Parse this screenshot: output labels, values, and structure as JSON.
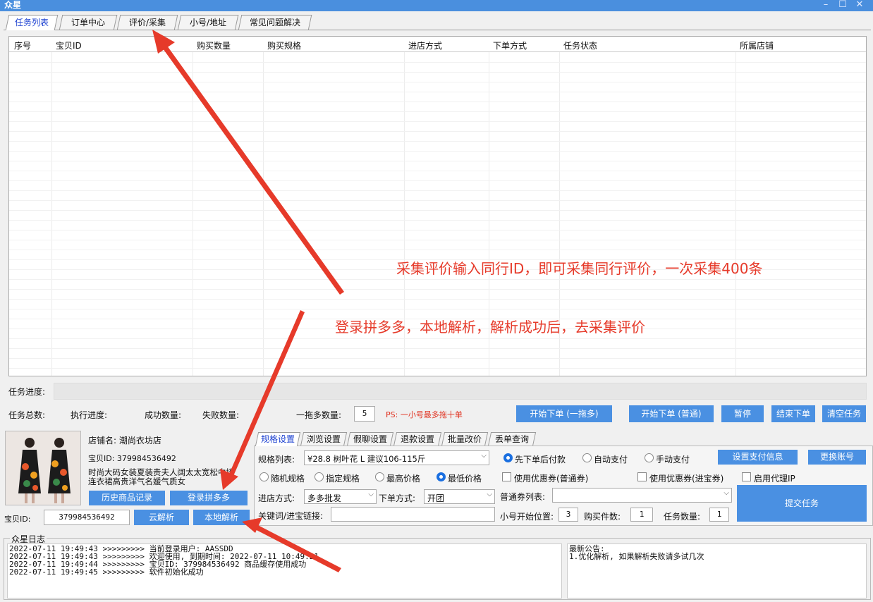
{
  "window": {
    "title": "众星",
    "min_icon": "minimize-icon",
    "max_icon": "maximize-icon",
    "close_icon": "close-icon"
  },
  "main_tabs": [
    {
      "label": "任务列表"
    },
    {
      "label": "订单中心"
    },
    {
      "label": "评价/采集"
    },
    {
      "label": "小号/地址"
    },
    {
      "label": "常见问题解决"
    }
  ],
  "table": {
    "columns": [
      "序号",
      "宝贝ID",
      "购买数量",
      "购买规格",
      "进店方式",
      "下单方式",
      "任务状态",
      "所属店铺"
    ]
  },
  "progress": {
    "label": "任务进度:"
  },
  "stats": {
    "total": "任务总数:",
    "exec": "执行进度:",
    "success": "成功数量:",
    "fail": "失败数量:",
    "multi_label": "一拖多数量:",
    "multi_value": "5",
    "ps": "PS: 一小号最多拖十单"
  },
  "action_buttons": {
    "start_multi": "开始下单 (一拖多)",
    "start_normal": "开始下单 (普通)",
    "pause": "暂停",
    "end": "结束下单",
    "clear": "清空任务"
  },
  "product": {
    "shop_name": "店铺名: 潮尚衣坊店",
    "item_id": "宝贝ID: 379984536492",
    "title_line1": "时尚大码女装夏装贵夫人阔太太宽松中接",
    "title_line2": "连衣裙高贵洋气名媛气质女",
    "history_btn": "历史商品记录",
    "login_btn": "登录拼多多",
    "id_label": "宝贝ID:",
    "id_value": "379984536492",
    "cloud_btn": "云解析",
    "local_btn": "本地解析"
  },
  "settings_tabs": [
    {
      "label": "规格设置"
    },
    {
      "label": "浏览设置"
    },
    {
      "label": "假聊设置"
    },
    {
      "label": "退款设置"
    },
    {
      "label": "批量改价"
    },
    {
      "label": "丢单查询"
    }
  ],
  "settings": {
    "spec_label": "规格列表:",
    "spec_value": "¥28.8  树叶花 L 建议106-115斤",
    "radio_random": "随机规格",
    "radio_specified": "指定规格",
    "radio_highest": "最高价格",
    "radio_lowest": "最低价格",
    "entry_label": "进店方式:",
    "entry_value": "多多批发",
    "order_label": "下单方式:",
    "order_value": "开团",
    "keyword_label": "关键词/进宝链接:",
    "keyword_value": "",
    "pay_after": "先下单后付款",
    "pay_auto": "自动支付",
    "pay_manual": "手动支付",
    "set_pay_btn": "设置支付信息",
    "switch_account_btn": "更换账号",
    "coupon_normal": "使用优惠券(普通券)",
    "coupon_jinbao": "使用优惠券(进宝券)",
    "proxy": "启用代理IP",
    "coupon_list_label": "普通券列表:",
    "start_pos_label": "小号开始位置:",
    "start_pos_value": "3",
    "buy_count_label": "购买件数:",
    "buy_count_value": "1",
    "task_count_label": "任务数量:",
    "task_count_value": "1",
    "submit_btn": "提交任务"
  },
  "log": {
    "title": "众星日志",
    "lines": [
      "2022-07-11 19:49:43 >>>>>>>>> 当前登录用户: AASSDD",
      "2022-07-11 19:49:43 >>>>>>>>> 欢迎使用, 到期时间: 2022-07-11 10:49:21",
      "2022-07-11 19:49:44 >>>>>>>>> 宝贝ID: 379984536492 商品缓存使用成功",
      "2022-07-11 19:49:45 >>>>>>>>> 软件初始化成功"
    ],
    "notice_title": "最新公告:",
    "notice_text": "1.优化解析, 如果解析失败请多试几次"
  },
  "annotations": {
    "a1": "采集评价输入同行ID，即可采集同行评价，一次采集400条",
    "a2": "登录拼多多，本地解析，解析成功后，去采集评价"
  },
  "colors": {
    "accent": "#4a90e2",
    "title_bar": "#4a8fde",
    "annotation": "#e63a2a",
    "active_tab_text": "#1a3fd0"
  }
}
